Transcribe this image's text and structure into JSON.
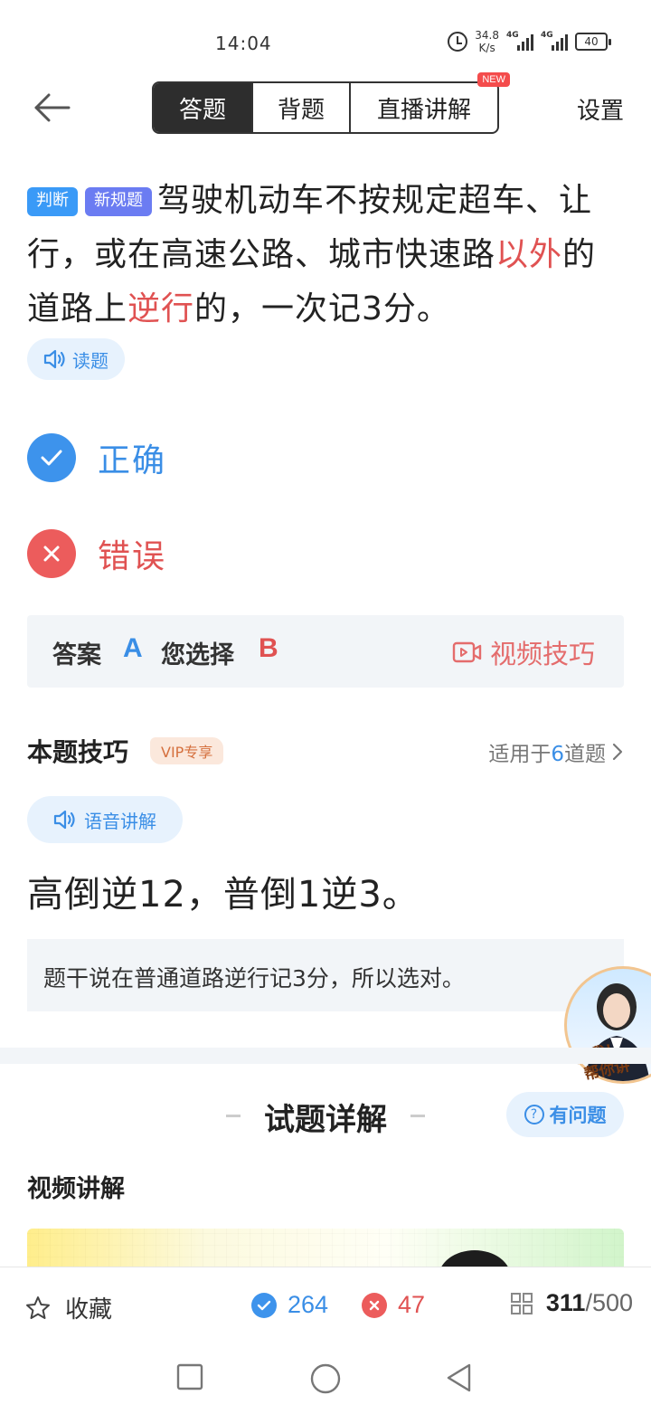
{
  "status_bar": {
    "time": "14:04",
    "net_speed_value": "34.8",
    "net_speed_unit": "K/s",
    "network_type_1": "4G",
    "network_type_2": "4G",
    "battery": "40"
  },
  "header": {
    "tabs": [
      {
        "label": "答题",
        "active": true
      },
      {
        "label": "背题",
        "active": false
      },
      {
        "label": "直播讲解",
        "active": false,
        "badge": "NEW"
      }
    ],
    "settings_label": "设置"
  },
  "question": {
    "type_tag": "判断",
    "new_rule_tag": "新规题",
    "text_part1": "驾驶机动车不按规定超车、让行，或在高速公路、城市快速路",
    "highlight1": "以外",
    "text_part2": "的道路上",
    "highlight2": "逆行",
    "text_part3": "的，一次记3分。",
    "read_label": "读题"
  },
  "options": {
    "correct_label": "正确",
    "wrong_label": "错误"
  },
  "answer": {
    "answer_label": "答案",
    "answer_value": "A",
    "chosen_label": "您选择",
    "chosen_value": "B",
    "video_tips_label": "视频技巧"
  },
  "tips": {
    "title": "本题技巧",
    "vip_tag": "VIP专享",
    "applies_prefix": "适用于",
    "applies_count": "6",
    "applies_suffix": "道题",
    "voice_label": "语音讲解",
    "mnemonic": "高倒逆12，普倒1逆3。",
    "explanation": "题干说在普通道路逆行记3分，所以选对。",
    "avatar_text": "点我！\n 帮你讲"
  },
  "detail": {
    "title": "试题详解",
    "ask_label": "有问题",
    "video_heading": "视频讲解"
  },
  "bottom_bar": {
    "favorite_label": "收藏",
    "correct_count": "264",
    "wrong_count": "47",
    "current": "311",
    "total": "/500"
  },
  "colors": {
    "accent_blue": "#3a8ee6",
    "accent_red": "#e05252",
    "tab_active_bg": "#2d2d2d"
  }
}
